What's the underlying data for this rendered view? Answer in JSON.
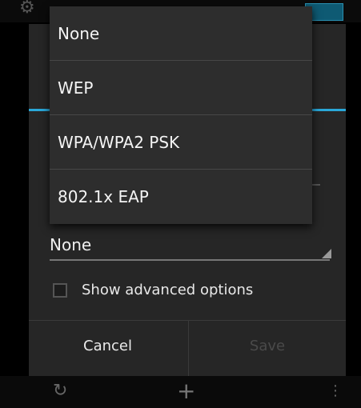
{
  "security_menu": {
    "options": [
      "None",
      "WEP",
      "WPA/WPA2 PSK",
      "802.1x EAP"
    ]
  },
  "dialog": {
    "security_value": "None",
    "show_advanced_label": "Show advanced options",
    "cancel_label": "Cancel",
    "save_label": "Save"
  },
  "colors": {
    "accent": "#2aa7d8",
    "dialog_bg": "#262626",
    "popup_bg": "#2d2d2d"
  },
  "icons": {
    "settings": "gear-icon",
    "refresh": "refresh-icon",
    "add": "plus-icon",
    "overflow": "overflow-menu-icon"
  }
}
